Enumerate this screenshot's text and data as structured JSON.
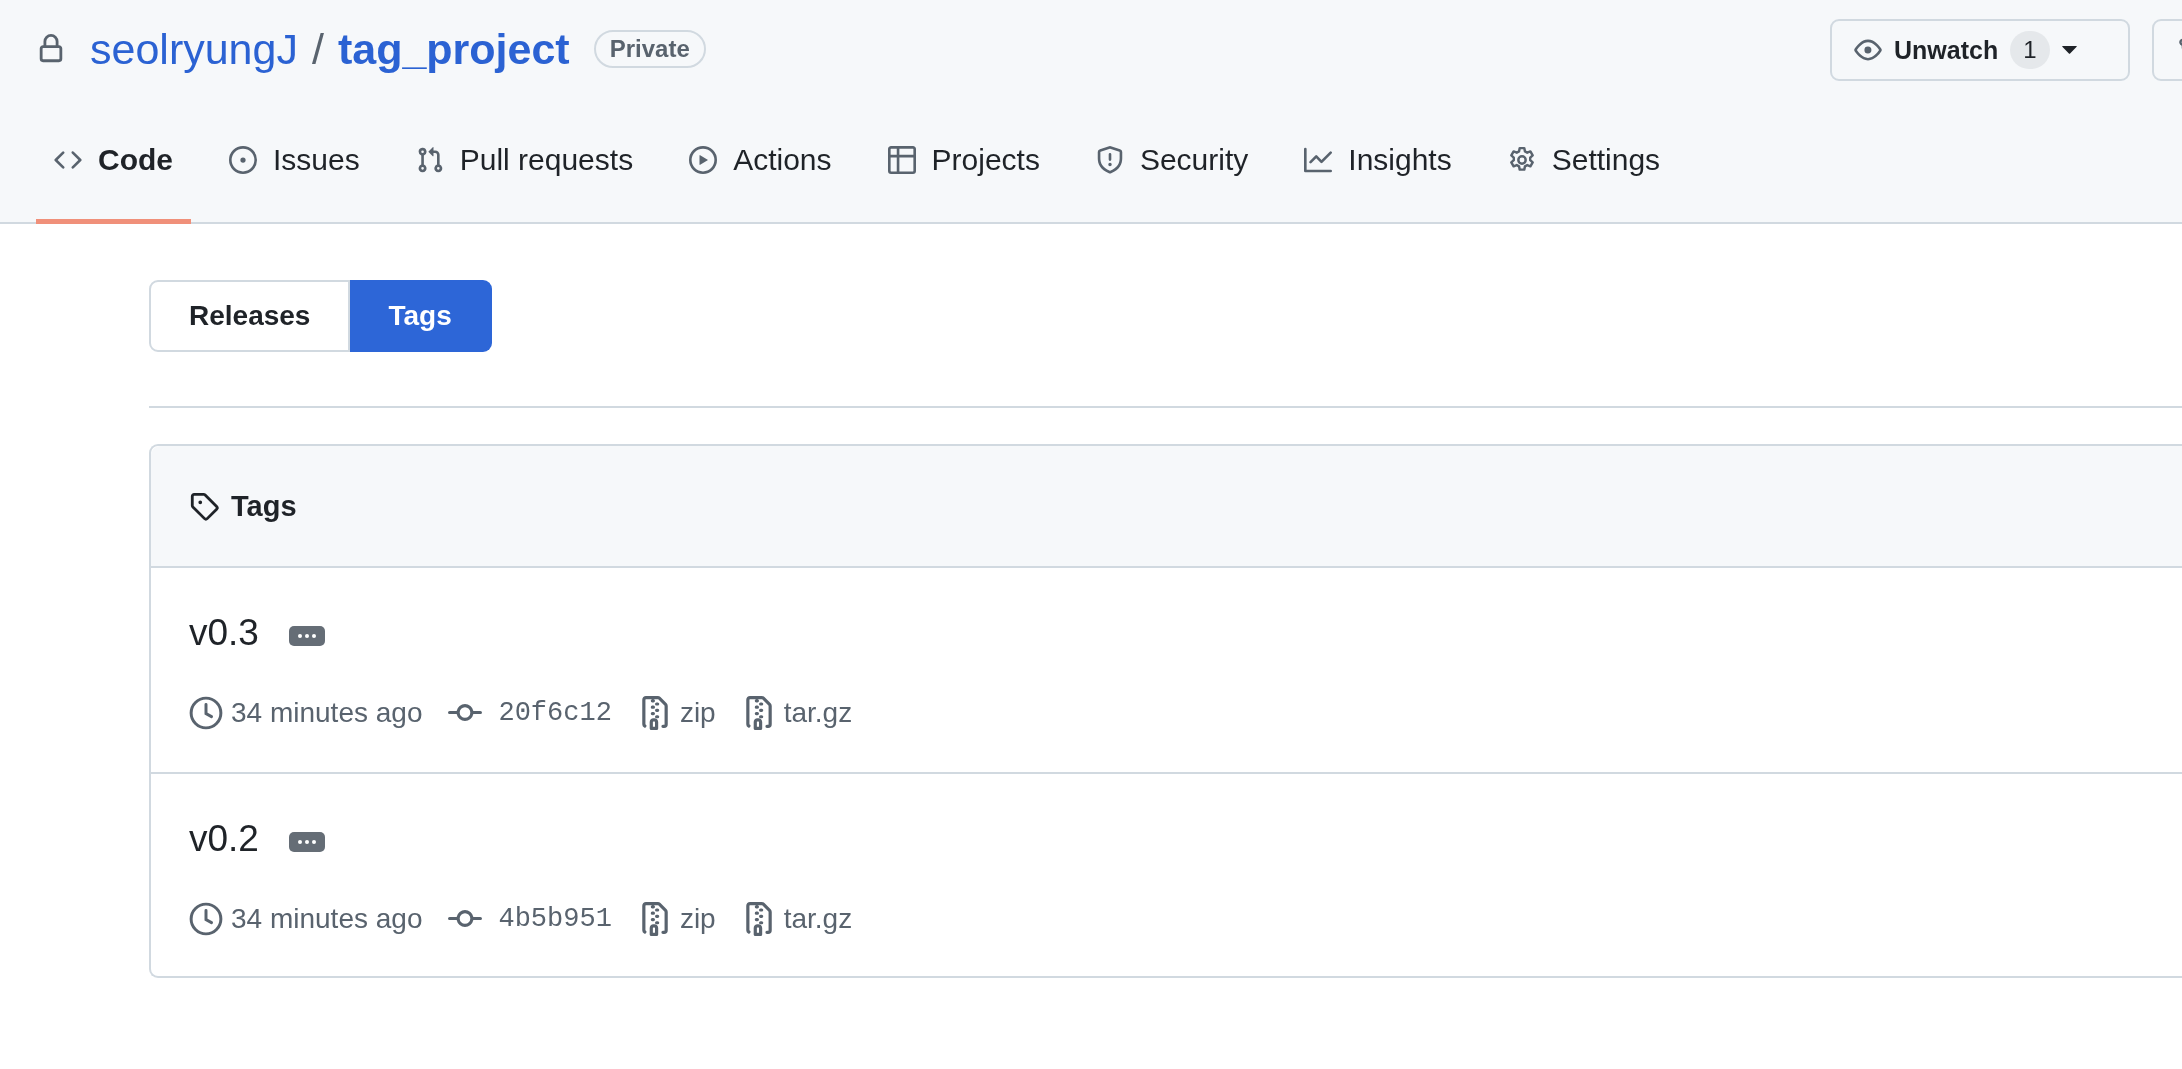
{
  "repo": {
    "owner": "seolryungJ",
    "separator": "/",
    "name": "tag_project",
    "visibility": "Private"
  },
  "watch": {
    "label": "Unwatch",
    "count": "1"
  },
  "tabs": [
    {
      "label": "Code",
      "kind": "code",
      "selected": true
    },
    {
      "label": "Issues",
      "kind": "issues",
      "selected": false
    },
    {
      "label": "Pull requests",
      "kind": "pull",
      "selected": false
    },
    {
      "label": "Actions",
      "kind": "actions",
      "selected": false
    },
    {
      "label": "Projects",
      "kind": "projects",
      "selected": false
    },
    {
      "label": "Security",
      "kind": "security",
      "selected": false
    },
    {
      "label": "Insights",
      "kind": "insights",
      "selected": false
    },
    {
      "label": "Settings",
      "kind": "settings",
      "selected": false
    }
  ],
  "switcher": [
    {
      "label": "Releases",
      "selected": false
    },
    {
      "label": "Tags",
      "selected": true
    }
  ],
  "tags_box": {
    "title": "Tags",
    "tags": [
      {
        "name": "v0.3",
        "time": "34 minutes ago",
        "commit": "20f6c12",
        "zip": "zip",
        "tarball": "tar.gz"
      },
      {
        "name": "v0.2",
        "time": "34 minutes ago",
        "commit": "4b5b951",
        "zip": "zip",
        "tarball": "tar.gz"
      }
    ]
  }
}
